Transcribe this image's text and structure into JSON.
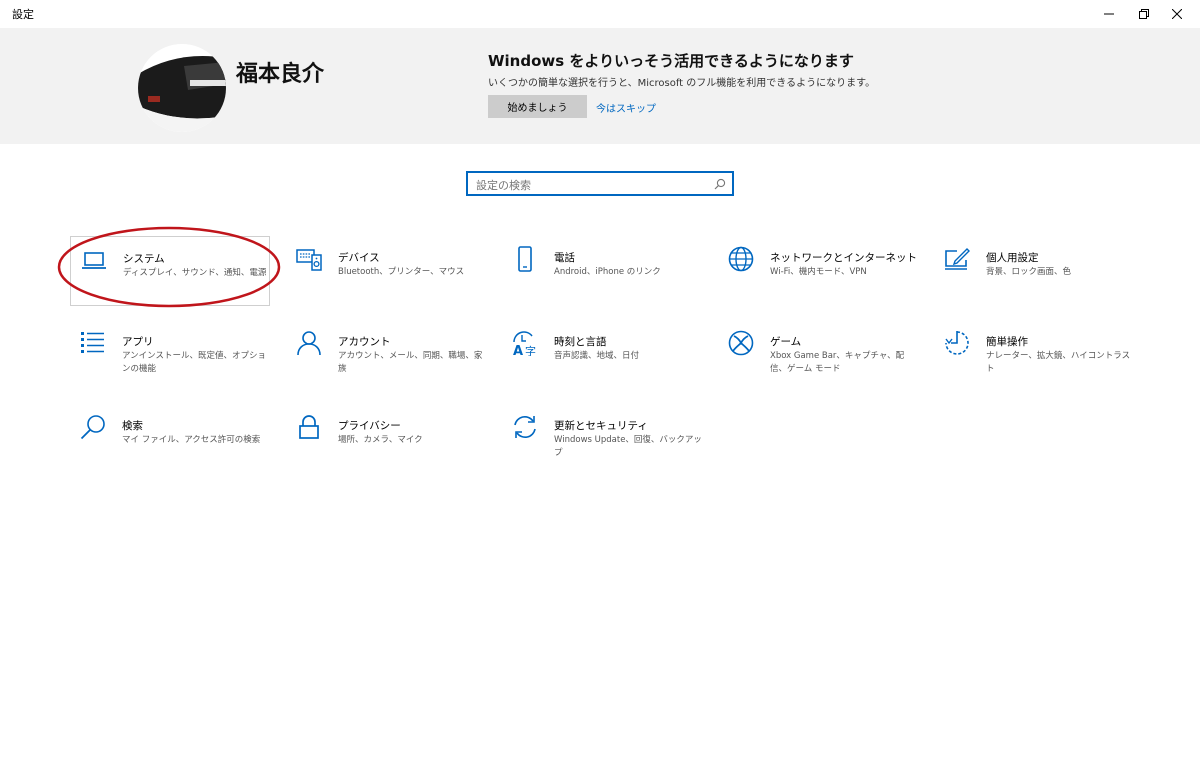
{
  "window": {
    "title": "設定"
  },
  "profile": {
    "name": "福本良介"
  },
  "promo": {
    "title": "Windows をよりいっそう活用できるようになります",
    "text": "いくつかの簡単な選択を行うと、Microsoft のフル機能を利用できるようになります。",
    "start_label": "始めましょう",
    "skip_label": "今はスキップ"
  },
  "search": {
    "placeholder": "設定の検索"
  },
  "accent_color": "#0067c0",
  "annotation_color": "#c0151b",
  "categories": [
    {
      "title": "システム",
      "desc": "ディスプレイ、サウンド、通知、電源",
      "icon": "laptop-icon"
    },
    {
      "title": "デバイス",
      "desc": "Bluetooth、プリンター、マウス",
      "icon": "devices-icon"
    },
    {
      "title": "電話",
      "desc": "Android、iPhone のリンク",
      "icon": "phone-icon"
    },
    {
      "title": "ネットワークとインターネット",
      "desc": "Wi-Fi、機内モード、VPN",
      "icon": "globe-icon"
    },
    {
      "title": "個人用設定",
      "desc": "背景、ロック画面、色",
      "icon": "personalize-icon"
    },
    {
      "title": "アプリ",
      "desc": "アンインストール、既定値、オプションの機能",
      "icon": "apps-list-icon"
    },
    {
      "title": "アカウント",
      "desc": "アカウント、メール、同期、職場、家族",
      "icon": "person-icon"
    },
    {
      "title": "時刻と言語",
      "desc": "音声認識、地域、日付",
      "icon": "time-language-icon"
    },
    {
      "title": "ゲーム",
      "desc": "Xbox Game Bar、キャプチャ、配信、ゲーム モード",
      "icon": "xbox-icon"
    },
    {
      "title": "簡単操作",
      "desc": "ナレーター、拡大鏡、ハイコントラスト",
      "icon": "ease-of-access-icon"
    },
    {
      "title": "検索",
      "desc": "マイ ファイル、アクセス許可の検索",
      "icon": "search-icon"
    },
    {
      "title": "プライバシー",
      "desc": "場所、カメラ、マイク",
      "icon": "lock-icon"
    },
    {
      "title": "更新とセキュリティ",
      "desc": "Windows Update、回復、バックアップ",
      "icon": "update-icon"
    }
  ]
}
